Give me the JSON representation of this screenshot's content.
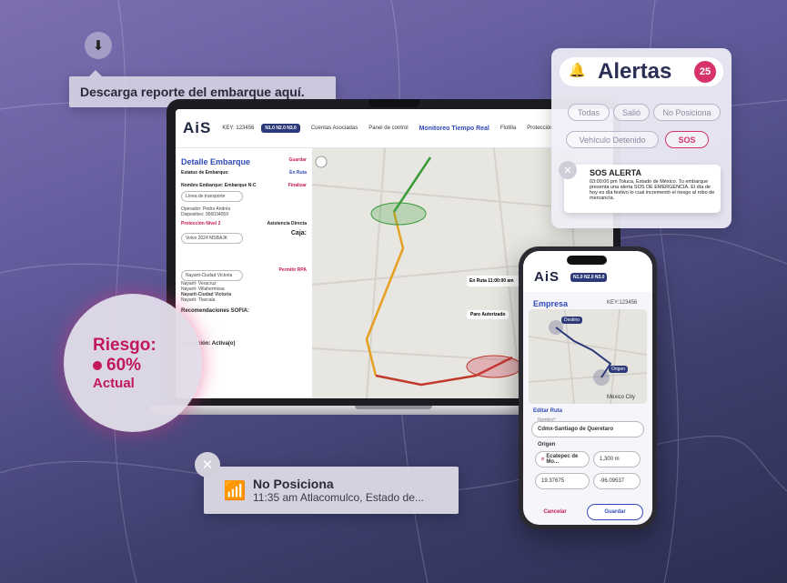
{
  "download": {
    "tooltip": "Descarga reporte del embarque aquí."
  },
  "laptop": {
    "logo": "AiS",
    "key": "KEY: 123456",
    "badge": "N1.0 N2.0 N3.0",
    "nav": [
      "Cuentas Asociadas",
      "Panel de control",
      "Monitoreo Tiempo Real",
      "Flotilla",
      "Protección"
    ],
    "panel": {
      "title": "Detalle Embarque",
      "save": "Guardar",
      "status_label": "Estatus de Embarque:",
      "status_value": "En Ruta",
      "name_label": "Nombre Embarque: Embarque N-C",
      "finish": "Finalizar",
      "transport_select": "Línea de transporte",
      "operator": "Operador: Pedro Andrés",
      "device": "Dispositivo: 956034059",
      "protection": "Protección Nivel 2",
      "assistance": "Asistencia Directa",
      "vehicle_select": "Volvo 2024 MSBAJK",
      "box_label": "Caja:",
      "route_select": "Nayarit-Ciudad Victoria",
      "rpa": "Permitir RPA",
      "route_options": [
        "Nayarit- Veracruz",
        "Nayarit- Villahermosa",
        "Nayarit-Ciudad Victoria",
        "Nayarit- Tlaxcala"
      ],
      "reco": "Recomendaciones SOFIA:",
      "activation": "Activación: Activa(o)"
    },
    "map_info": {
      "route": "En Ruta 11:00:00 am",
      "stop": "Paro Autorizado"
    }
  },
  "risk": {
    "label": "Riesgo:",
    "value": "60%",
    "sub": "Actual"
  },
  "alerts": {
    "title": "Alertas",
    "count": "25",
    "filters": [
      "Todas",
      "Salió",
      "No Posiciona",
      "Vehículo Detenido",
      "SOS"
    ],
    "selected": "SOS",
    "sos_title": "SOS ALERTA",
    "sos_text": "03:00:00 pm Toluca, Estado de México. Tu embarque presenta una alerta SOS DE EMERGENCIA. El día de hoy es día festivo lo cual incrementó el riesgo al robo de mercancía."
  },
  "toast": {
    "title": "No Posiciona",
    "subtitle": "11:35 am Atlacomulco, Estado de..."
  },
  "phone": {
    "logo": "AiS",
    "badge": "N1.0 N2.0 N3.0",
    "company": "Empresa",
    "key": "KEY:123456",
    "edit_route": "Editar Ruta",
    "name_label": "Nombre*",
    "name_value": "Cdmx-Santiago de Queretaro",
    "origin": "Origen",
    "origin_value": "Ecatepec de Mo...",
    "distance": "1,300 m",
    "lat": "19.37675",
    "lng": "-96.09537",
    "cancel": "Cancelar",
    "save": "Guardar",
    "map_labels": {
      "destino": "Destino",
      "origen": "Origen",
      "city": "México City"
    }
  },
  "colors": {
    "accent": "#d6336c",
    "brand": "#2f49b7"
  }
}
